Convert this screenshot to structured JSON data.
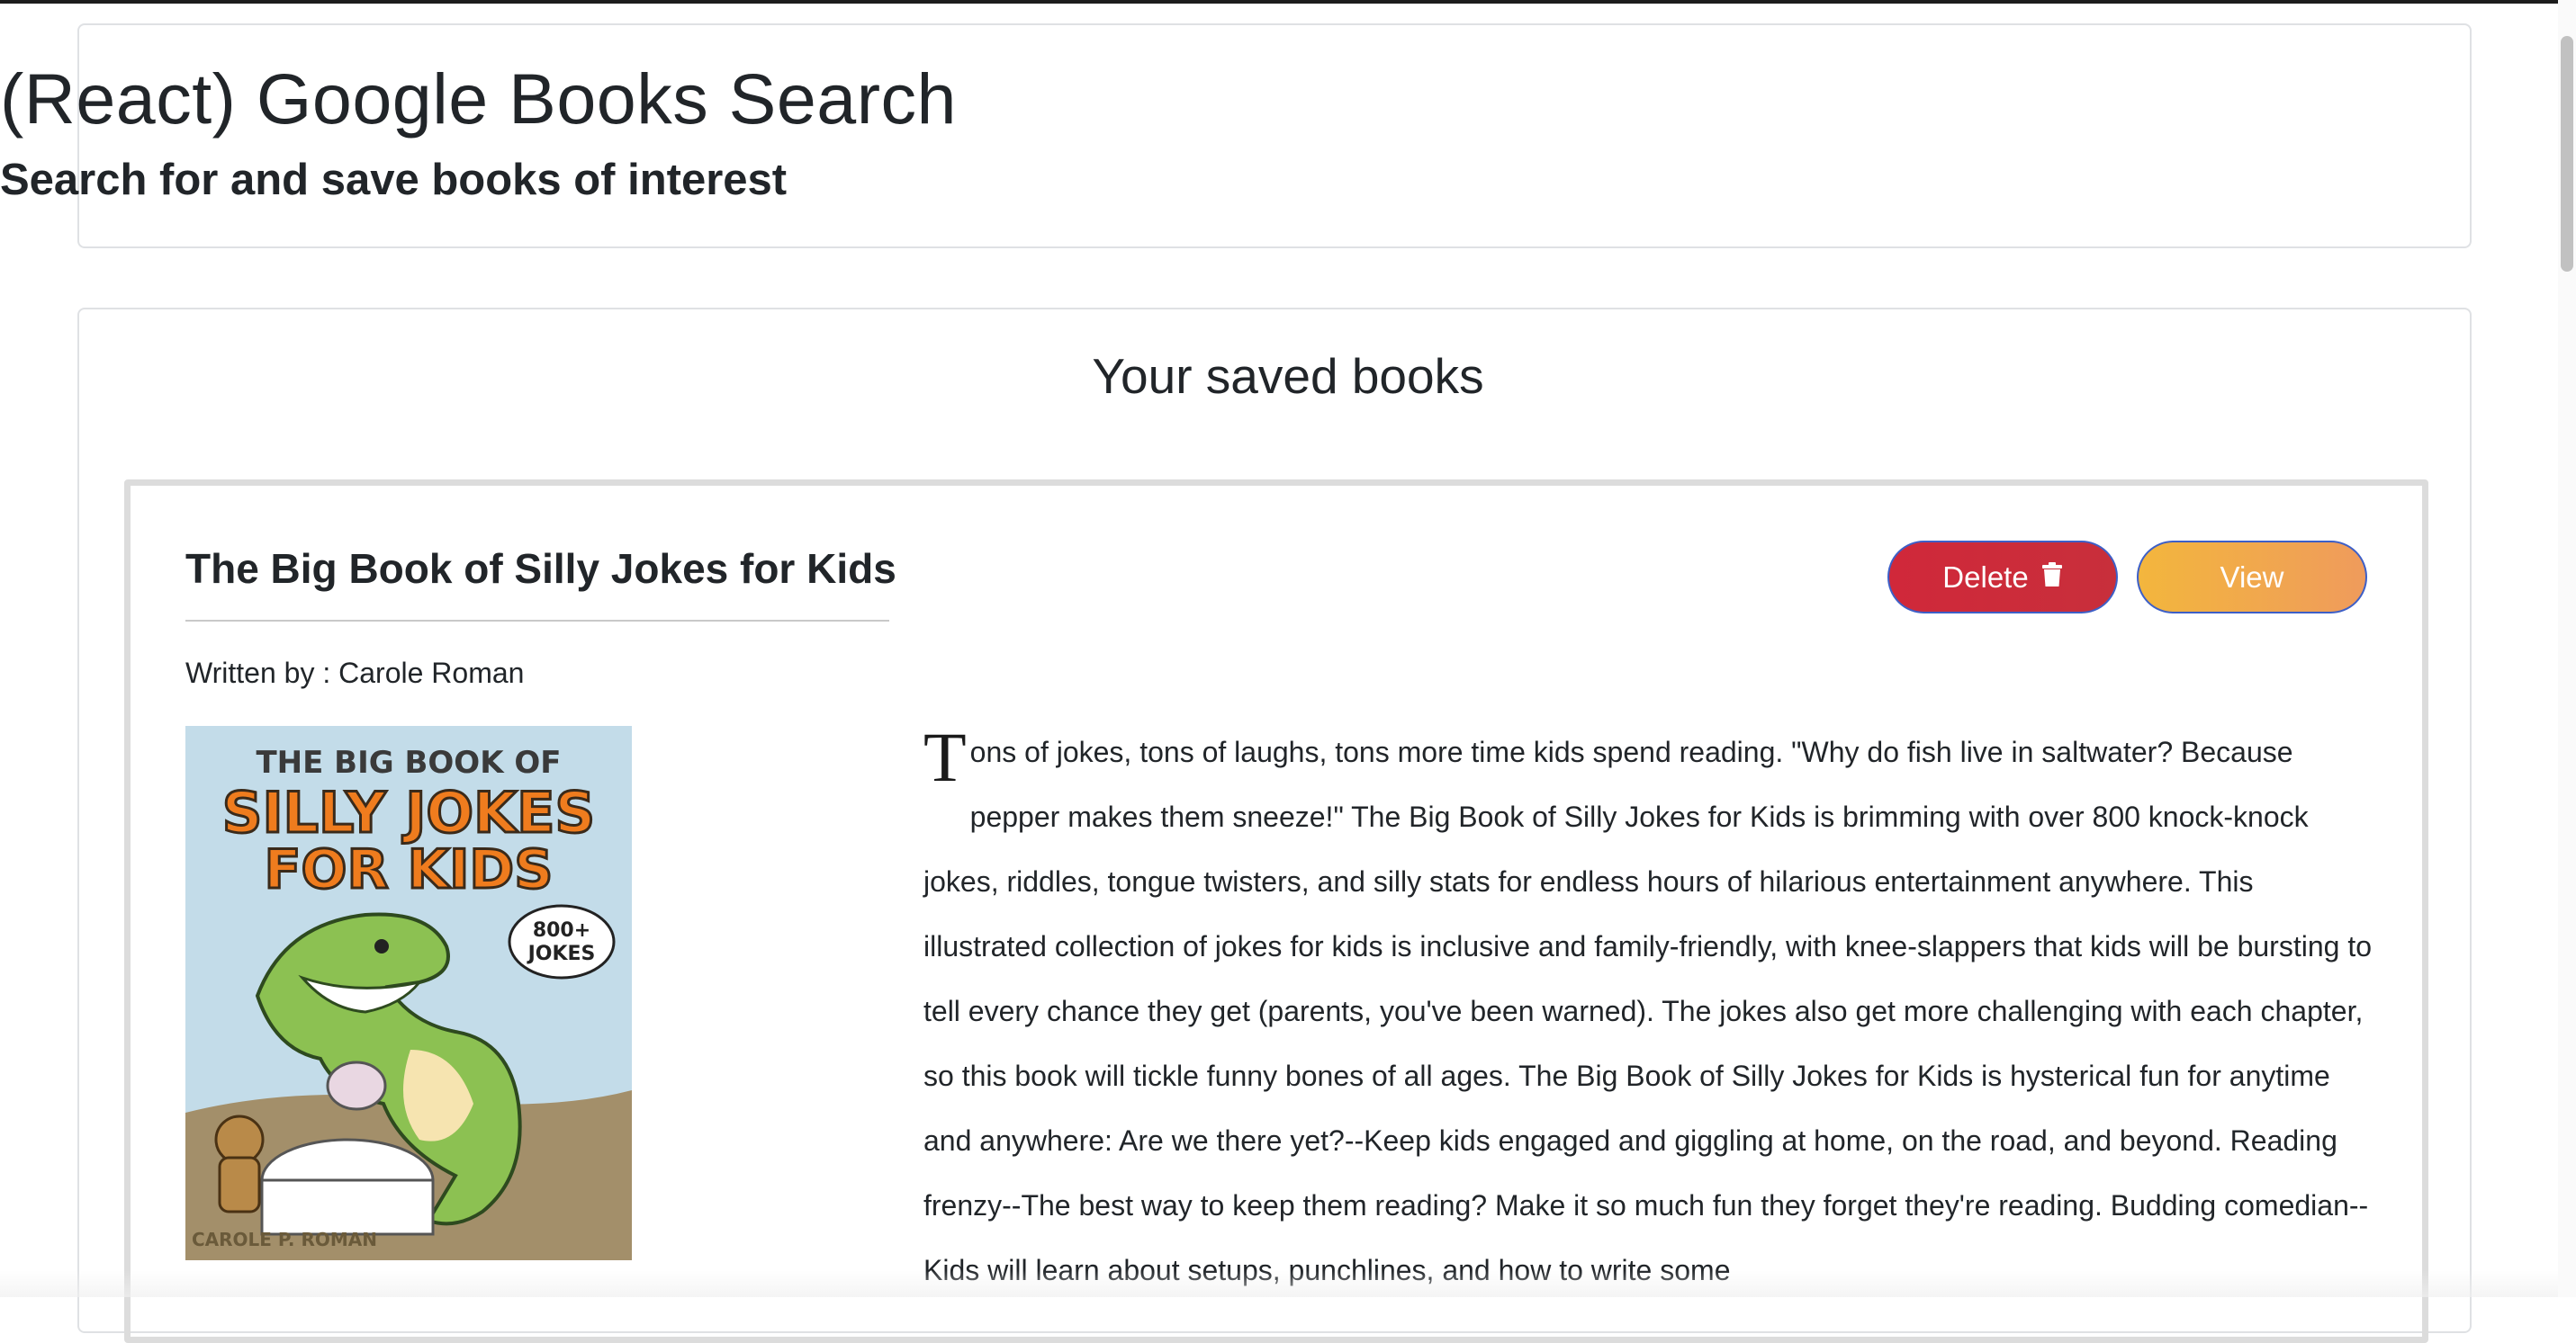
{
  "header": {
    "title": "(React) Google Books Search",
    "subtitle": "Search for and save books of interest"
  },
  "saved": {
    "heading": "Your saved books",
    "books": [
      {
        "title": "The Big Book of Silly Jokes for Kids",
        "author_line": "Written by : Carole Roman",
        "delete_label": "Delete",
        "view_label": "View",
        "cover": {
          "line1": "THE BIG BOOK OF",
          "line2": "SILLY JOKES",
          "line3": "FOR KIDS",
          "badge_line1": "800+",
          "badge_line2": "JOKES",
          "author": "CAROLE P. ROMAN"
        },
        "description_first_letter": "T",
        "description_rest": "ons of jokes, tons of laughs, tons more time kids spend reading. \"Why do fish live in saltwater? Because pepper makes them sneeze!\" The Big Book of Silly Jokes for Kids is brimming with over 800 knock-knock jokes, riddles, tongue twisters, and silly stats for endless hours of hilarious entertainment anywhere. This illustrated collection of jokes for kids is inclusive and family-friendly, with knee-slappers that kids will be bursting to tell every chance they get (parents, you've been warned). The jokes also get more challenging with each chapter, so this book will tickle funny bones of all ages. The Big Book of Silly Jokes for Kids is hysterical fun for anytime and anywhere: Are we there yet?--Keep kids engaged and giggling at home, on the road, and beyond. Reading frenzy--The best way to keep them reading? Make it so much fun they forget they're reading. Budding comedian--Kids will learn about setups, punchlines, and how to write some"
      }
    ]
  },
  "colors": {
    "delete_button": "#d0283a",
    "view_button_start": "#f3b63d",
    "view_button_end": "#ef9b5c",
    "button_border": "#3d5fc7"
  }
}
